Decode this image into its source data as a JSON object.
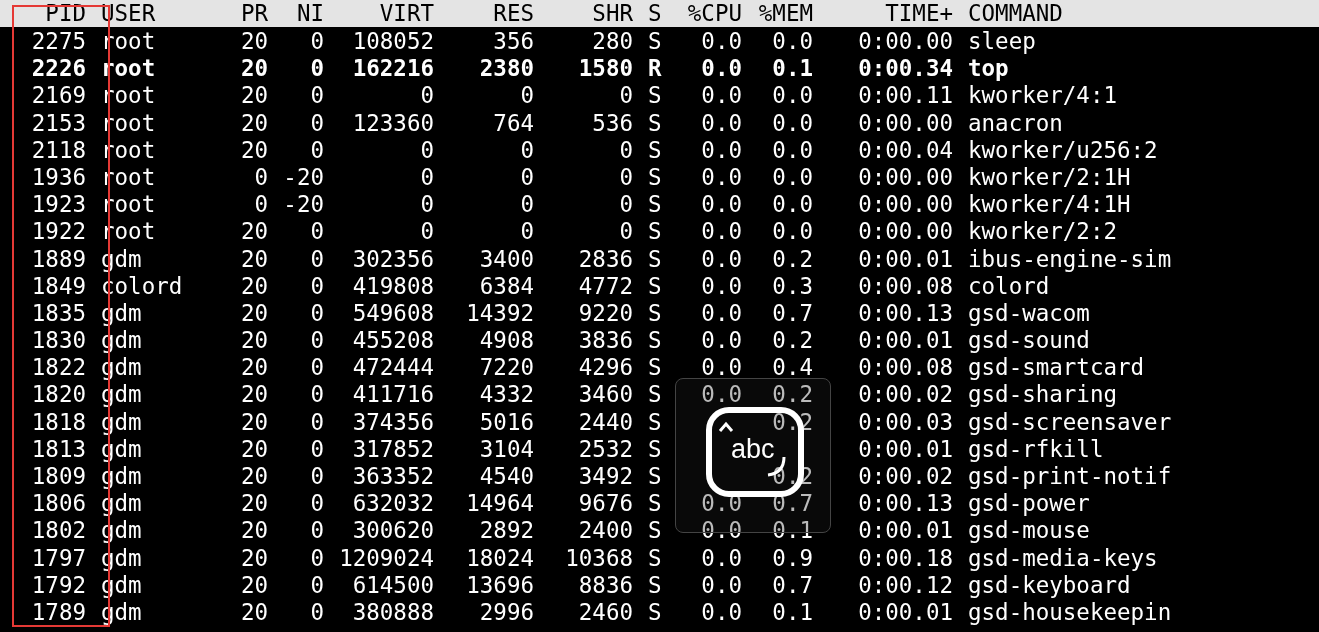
{
  "table": {
    "columns": [
      "PID",
      "USER",
      "PR",
      "NI",
      "VIRT",
      "RES",
      "SHR",
      "S",
      "%CPU",
      "%MEM",
      "TIME+",
      "COMMAND"
    ],
    "rows": [
      {
        "cells": [
          "2275",
          "root",
          "20",
          "0",
          "108052",
          "356",
          "280",
          "S",
          "0.0",
          "0.0",
          "0:00.00",
          "sleep"
        ],
        "highlighted": false
      },
      {
        "cells": [
          "2226",
          "root",
          "20",
          "0",
          "162216",
          "2380",
          "1580",
          "R",
          "0.0",
          "0.1",
          "0:00.34",
          "top"
        ],
        "highlighted": true
      },
      {
        "cells": [
          "2169",
          "root",
          "20",
          "0",
          "0",
          "0",
          "0",
          "S",
          "0.0",
          "0.0",
          "0:00.11",
          "kworker/4:1"
        ],
        "highlighted": false
      },
      {
        "cells": [
          "2153",
          "root",
          "20",
          "0",
          "123360",
          "764",
          "536",
          "S",
          "0.0",
          "0.0",
          "0:00.00",
          "anacron"
        ],
        "highlighted": false
      },
      {
        "cells": [
          "2118",
          "root",
          "20",
          "0",
          "0",
          "0",
          "0",
          "S",
          "0.0",
          "0.0",
          "0:00.04",
          "kworker/u256:2"
        ],
        "highlighted": false
      },
      {
        "cells": [
          "1936",
          "root",
          "0",
          "-20",
          "0",
          "0",
          "0",
          "S",
          "0.0",
          "0.0",
          "0:00.00",
          "kworker/2:1H"
        ],
        "highlighted": false
      },
      {
        "cells": [
          "1923",
          "root",
          "0",
          "-20",
          "0",
          "0",
          "0",
          "S",
          "0.0",
          "0.0",
          "0:00.00",
          "kworker/4:1H"
        ],
        "highlighted": false
      },
      {
        "cells": [
          "1922",
          "root",
          "20",
          "0",
          "0",
          "0",
          "0",
          "S",
          "0.0",
          "0.0",
          "0:00.00",
          "kworker/2:2"
        ],
        "highlighted": false
      },
      {
        "cells": [
          "1889",
          "gdm",
          "20",
          "0",
          "302356",
          "3400",
          "2836",
          "S",
          "0.0",
          "0.2",
          "0:00.01",
          "ibus-engine-sim"
        ],
        "highlighted": false
      },
      {
        "cells": [
          "1849",
          "colord",
          "20",
          "0",
          "419808",
          "6384",
          "4772",
          "S",
          "0.0",
          "0.3",
          "0:00.08",
          "colord"
        ],
        "highlighted": false
      },
      {
        "cells": [
          "1835",
          "gdm",
          "20",
          "0",
          "549608",
          "14392",
          "9220",
          "S",
          "0.0",
          "0.7",
          "0:00.13",
          "gsd-wacom"
        ],
        "highlighted": false
      },
      {
        "cells": [
          "1830",
          "gdm",
          "20",
          "0",
          "455208",
          "4908",
          "3836",
          "S",
          "0.0",
          "0.2",
          "0:00.01",
          "gsd-sound"
        ],
        "highlighted": false
      },
      {
        "cells": [
          "1822",
          "gdm",
          "20",
          "0",
          "472444",
          "7220",
          "4296",
          "S",
          "0.0",
          "0.4",
          "0:00.08",
          "gsd-smartcard"
        ],
        "highlighted": false
      },
      {
        "cells": [
          "1820",
          "gdm",
          "20",
          "0",
          "411716",
          "4332",
          "3460",
          "S",
          "0.0",
          "0.2",
          "0:00.02",
          "gsd-sharing"
        ],
        "highlighted": false
      },
      {
        "cells": [
          "1818",
          "gdm",
          "20",
          "0",
          "374356",
          "5016",
          "2440",
          "S",
          null,
          "0.2",
          "0:00.03",
          "gsd-screensaver"
        ],
        "highlighted": false
      },
      {
        "cells": [
          "1813",
          "gdm",
          "20",
          "0",
          "317852",
          "3104",
          "2532",
          "S",
          null,
          null,
          "0:00.01",
          "gsd-rfkill"
        ],
        "highlighted": false
      },
      {
        "cells": [
          "1809",
          "gdm",
          "20",
          "0",
          "363352",
          "4540",
          "3492",
          "S",
          null,
          "0.2",
          "0:00.02",
          "gsd-print-notif"
        ],
        "highlighted": false
      },
      {
        "cells": [
          "1806",
          "gdm",
          "20",
          "0",
          "632032",
          "14964",
          "9676",
          "S",
          "0.0",
          "0.7",
          "0:00.13",
          "gsd-power"
        ],
        "highlighted": false
      },
      {
        "cells": [
          "1802",
          "gdm",
          "20",
          "0",
          "300620",
          "2892",
          "2400",
          "S",
          "0.0",
          "0.1",
          "0:00.01",
          "gsd-mouse"
        ],
        "highlighted": false
      },
      {
        "cells": [
          "1797",
          "gdm",
          "20",
          "0",
          "1209024",
          "18024",
          "10368",
          "S",
          "0.0",
          "0.9",
          "0:00.18",
          "gsd-media-keys"
        ],
        "highlighted": false
      },
      {
        "cells": [
          "1792",
          "gdm",
          "20",
          "0",
          "614500",
          "13696",
          "8836",
          "S",
          "0.0",
          "0.7",
          "0:00.12",
          "gsd-keyboard"
        ],
        "highlighted": false
      },
      {
        "cells": [
          "1789",
          "gdm",
          "20",
          "0",
          "380888",
          "2996",
          "2460",
          "S",
          "0.0",
          "0.1",
          "0:00.01",
          "gsd-housekeepin"
        ],
        "highlighted": false
      }
    ]
  },
  "input_method_popup": {
    "label": "abc"
  }
}
